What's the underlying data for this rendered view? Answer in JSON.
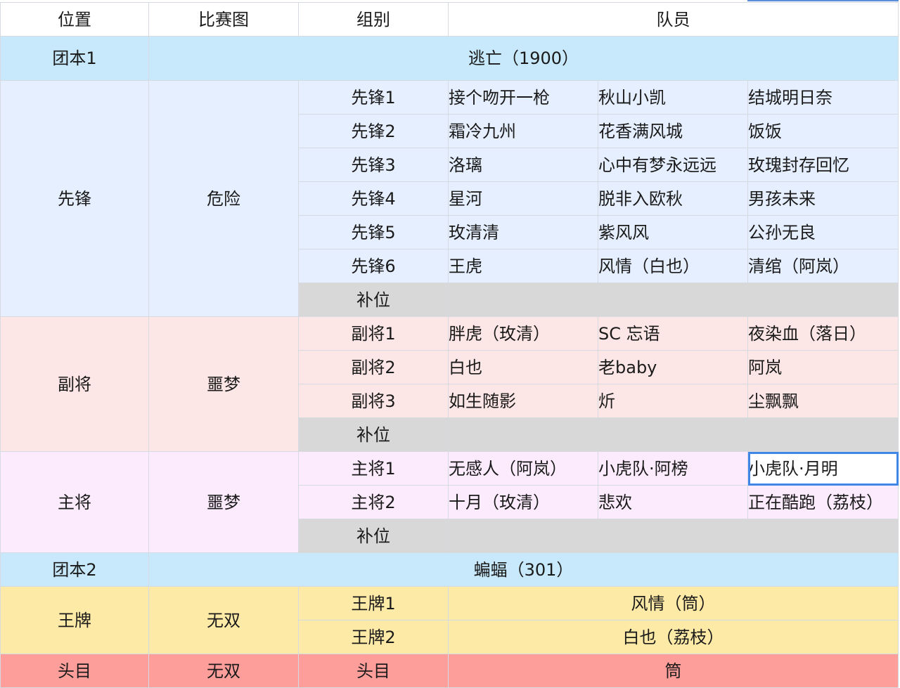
{
  "headers": [
    "位置",
    "比赛图",
    "组别",
    "队员"
  ],
  "team1": {
    "label": "团本1",
    "title": "逃亡（1900）"
  },
  "vanguard": {
    "position": "先锋",
    "map": "危险",
    "groups": [
      {
        "name": "先锋1",
        "members": [
          "接个吻开一枪",
          "秋山小凯",
          "结城明日奈"
        ]
      },
      {
        "name": "先锋2",
        "members": [
          "霜冷九州",
          "花香满风城",
          "饭饭"
        ]
      },
      {
        "name": "先锋3",
        "members": [
          "洛璃",
          "心中有梦永远远",
          "玫瑰封存回忆"
        ]
      },
      {
        "name": "先锋4",
        "members": [
          "星河",
          "脱非入欧秋",
          "男孩未来"
        ]
      },
      {
        "name": "先锋5",
        "members": [
          "玫清清",
          "紫风风",
          "公孙无良"
        ]
      },
      {
        "name": "先锋6",
        "members": [
          "王虎",
          "风情（白也）",
          "清绾（阿岚）"
        ]
      }
    ],
    "sub": "补位"
  },
  "deputy": {
    "position": "副将",
    "map": "噩梦",
    "groups": [
      {
        "name": "副将1",
        "members": [
          "胖虎（玫清）",
          "SC 忘语",
          "夜染血（落日）"
        ]
      },
      {
        "name": "副将2",
        "members": [
          "白也",
          "老baby",
          "阿岚"
        ]
      },
      {
        "name": "副将3",
        "members": [
          "如生随影",
          "炘",
          "尘飘飘"
        ]
      }
    ],
    "sub": "补位"
  },
  "general": {
    "position": "主将",
    "map": "噩梦",
    "groups": [
      {
        "name": "主将1",
        "members": [
          "无感人（阿岚）",
          "小虎队·阿榜",
          "小虎队·月明"
        ]
      },
      {
        "name": "主将2",
        "members": [
          "十月（玫清）",
          "悲欢",
          "正在酷跑（荔枝）"
        ]
      }
    ],
    "sub": "补位"
  },
  "team2": {
    "label": "团本2",
    "title": "蝙蝠（301）"
  },
  "ace": {
    "position": "王牌",
    "map": "无双",
    "groups": [
      {
        "name": "王牌1",
        "member": "风情（筒）"
      },
      {
        "name": "王牌2",
        "member": "白也（荔枝）"
      }
    ]
  },
  "boss": {
    "position": "头目",
    "map": "无双",
    "group": "头目",
    "member": "筒"
  },
  "colors": {
    "team_row": "#c7e9fb",
    "vanguard": "#e5efff",
    "deputy": "#fde7e6",
    "general": "#fbebfc",
    "substitute": "#d8d8d8",
    "ace": "#feeaa7",
    "boss": "#fe9e9b",
    "selection": "#3f86e6"
  }
}
